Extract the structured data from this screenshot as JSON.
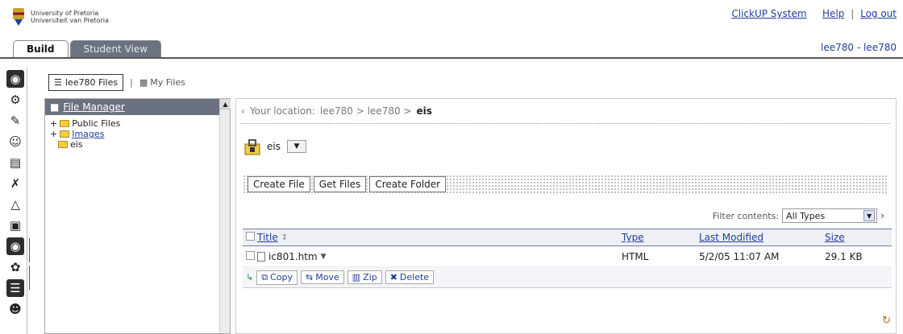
{
  "header": {
    "logo_line1": "University of Pretoria",
    "logo_line2": "Universiteit van Pretoria",
    "system_link": "ClickUP System",
    "help_link": "Help",
    "logout_link": "Log out",
    "user": "lee780 - lee780",
    "tabs": [
      {
        "label": "Build",
        "active": true
      },
      {
        "label": "Student View",
        "active": false
      }
    ]
  },
  "library": {
    "current": "lee780 Files",
    "other": "My Files"
  },
  "tree": {
    "header": "File Manager",
    "items": [
      {
        "label": "Public Files",
        "expand": "+"
      },
      {
        "label": "Images",
        "expand": "+"
      },
      {
        "label": "eis",
        "expand": ""
      }
    ]
  },
  "content": {
    "location_label": "Your location:",
    "location_path": "lee780 > lee780 >",
    "location_current": "eis",
    "folder_name": "eis",
    "buttons": [
      "Create File",
      "Get Files",
      "Create Folder"
    ],
    "filter_label": "Filter contents:",
    "filter_value": "All Types",
    "columns": [
      "Title",
      "Type",
      "Last Modified",
      "Size"
    ],
    "rows": [
      {
        "title": "ic801.htm",
        "type": "HTML",
        "modified": "5/2/05 11:07 AM",
        "size": "29.1 KB"
      }
    ],
    "bottom_buttons": [
      "Copy",
      "Move",
      "Zip",
      "Delete"
    ]
  },
  "colors": {
    "link": "#1f3f99",
    "panel_header": "#6b7180",
    "tab_inactive": "#6b7280"
  }
}
